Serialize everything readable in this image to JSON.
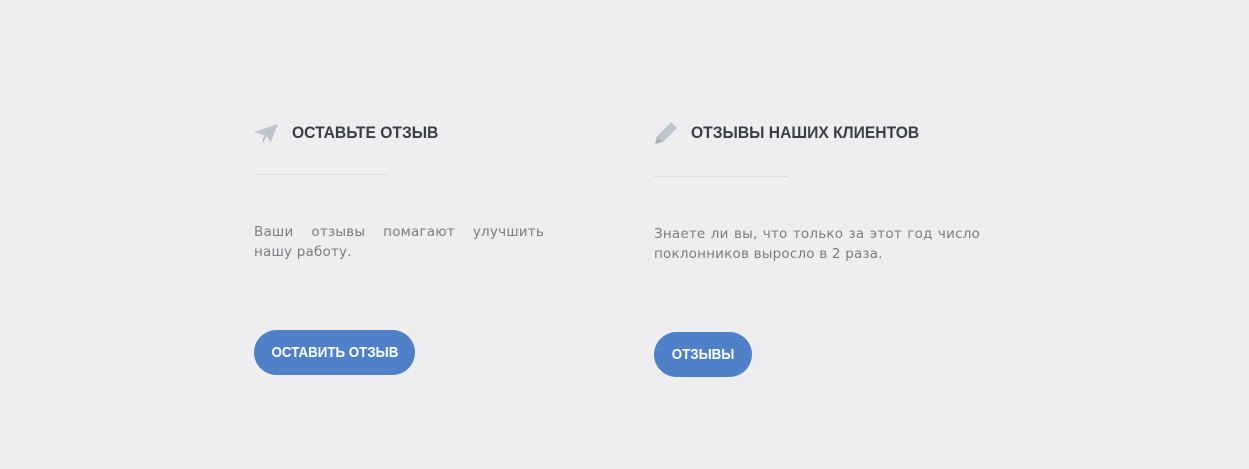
{
  "colors": {
    "background": "#eeeef0",
    "title": "#3a3f47",
    "text": "#7a7d82",
    "icon": "#bfc6cf",
    "divider": "#dcdde1",
    "button": "#4f80c8",
    "button_text": "#ffffff"
  },
  "leave_review": {
    "icon": "paper-plane-icon",
    "title": "ОСТАВЬТЕ ОТЗЫВ",
    "text": "Ваши отзывы помагают улучшить нашу работу.",
    "button_label": "ОСТАВИТЬ ОТЗЫВ"
  },
  "client_reviews": {
    "icon": "pencil-icon",
    "title": "ОТЗЫВЫ НАШИХ КЛИЕНТОВ",
    "text": "Знаете ли вы, что только за этот год число поклонников выросло в 2 раза.",
    "button_label": "ОТЗЫВЫ"
  }
}
